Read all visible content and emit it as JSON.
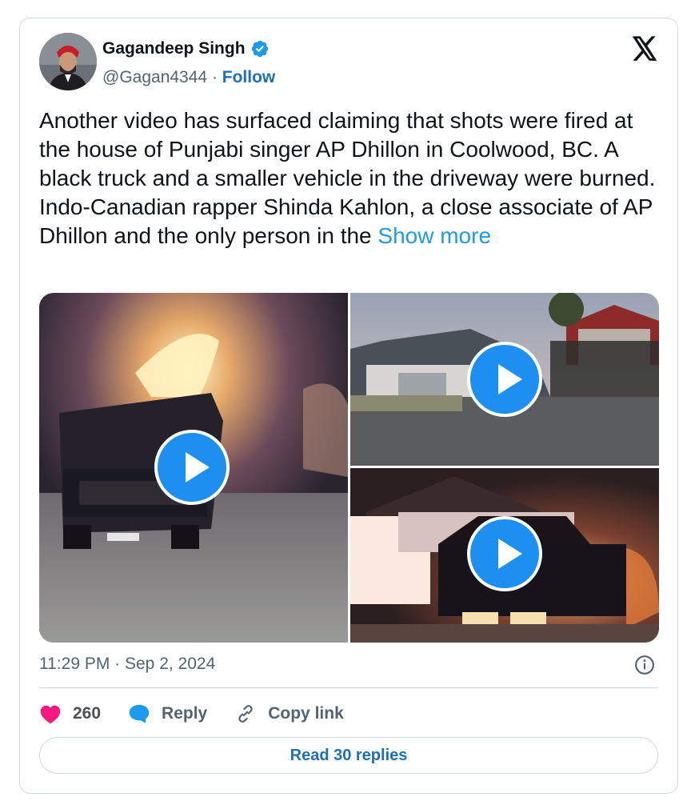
{
  "author": {
    "name": "Gagandeep Singh",
    "handle": "@Gagan4344",
    "separator": "·",
    "follow_label": "Follow"
  },
  "tweet": {
    "text": "Another video has surfaced claiming that shots were fired at the house of Punjabi singer AP Dhillon in Coolwood, BC. A black truck and a smaller vehicle in the driveway were burned. Indo-Canadian rapper Shinda Kahlon, a close associate of AP Dhillon and the only person in the",
    "show_more": "Show more",
    "timestamp": "11:29 PM · Sep 2, 2024"
  },
  "media": [
    {
      "type": "video",
      "icon": "play-icon"
    },
    {
      "type": "video",
      "icon": "play-icon"
    },
    {
      "type": "video",
      "icon": "play-icon"
    }
  ],
  "actions": {
    "likes": "260",
    "reply_label": "Reply",
    "copy_link_label": "Copy link"
  },
  "read_replies_label": "Read 30 replies",
  "colors": {
    "accent": "#1d9bf0",
    "like": "#f91880",
    "border": "#cfd9de",
    "secondary_text": "#536471"
  }
}
